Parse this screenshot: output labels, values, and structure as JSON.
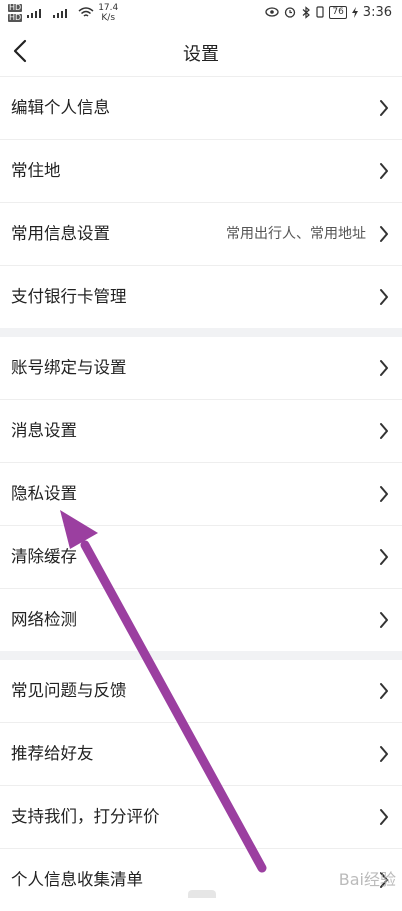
{
  "status_bar": {
    "sim_labels": [
      "HD",
      "HD"
    ],
    "net_speed": "17.4",
    "net_unit": "K/s",
    "battery": "76",
    "time": "3:36"
  },
  "header": {
    "title": "设置"
  },
  "groups": [
    {
      "rows": [
        {
          "label": "编辑个人信息",
          "value": ""
        },
        {
          "label": "常住地",
          "value": ""
        },
        {
          "label": "常用信息设置",
          "value": "常用出行人、常用地址"
        },
        {
          "label": "支付银行卡管理",
          "value": ""
        }
      ]
    },
    {
      "rows": [
        {
          "label": "账号绑定与设置",
          "value": ""
        },
        {
          "label": "消息设置",
          "value": ""
        },
        {
          "label": "隐私设置",
          "value": ""
        },
        {
          "label": "清除缓存",
          "value": ""
        },
        {
          "label": "网络检测",
          "value": ""
        }
      ]
    },
    {
      "rows": [
        {
          "label": "常见问题与反馈",
          "value": ""
        },
        {
          "label": "推荐给好友",
          "value": ""
        },
        {
          "label": "支持我们，打分评价",
          "value": ""
        },
        {
          "label": "个人信息收集清单",
          "value": ""
        }
      ]
    }
  ],
  "overlay": {
    "arrow_color": "#9b3fa0",
    "watermark": "Bai经验"
  },
  "colors": {
    "separator": "#f1f2f4",
    "text": "#222222"
  }
}
